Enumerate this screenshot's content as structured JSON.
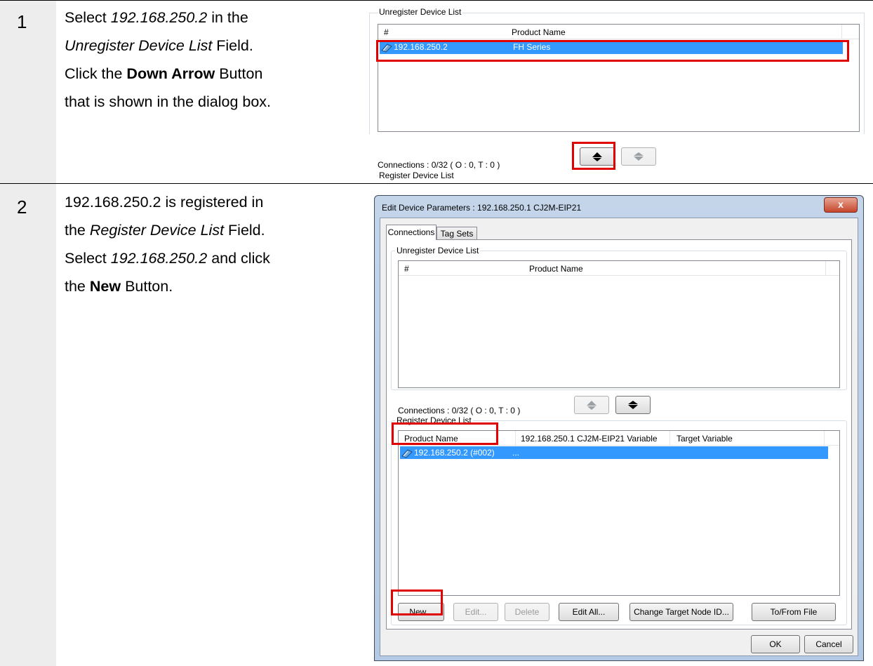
{
  "steps": [
    {
      "number": "1",
      "t1": "Select ",
      "t1_ip": "192.168.250.2",
      "t1_end": " in the",
      "t2_field": "Unregister Device List",
      "t2_end": " Field.",
      "t3_a": "Click the ",
      "t3_bold": "Down Arrow",
      "t3_end": " Button",
      "t4": "that is shown in the dialog box."
    },
    {
      "number": "2",
      "t1": "192.168.250.2 is registered in",
      "t2_a": "the ",
      "t2_field": "Register Device List",
      "t2_end": " Field.",
      "t3_a": "Select ",
      "t3_ip": "192.168.250.2",
      "t3_end": " and click",
      "t4_a": "the ",
      "t4_bold": "New",
      "t4_end": " Button."
    }
  ],
  "screenshot1": {
    "group_label": "Unregister Device List",
    "col_hash": "#",
    "col_product": "Product Name",
    "row_ip": "192.168.250.2",
    "row_product": "FH Series",
    "connections": "Connections :  0/32 ( O : 0, T : 0 )",
    "register_label": "Register Device List"
  },
  "dialog": {
    "title": "Edit Device Parameters : 192.168.250.1 CJ2M-EIP21",
    "close": "x",
    "tabs": [
      "Connections",
      "Tag Sets"
    ],
    "unregister_label": "Unregister Device List",
    "col_hash": "#",
    "col_product": "Product Name",
    "connections": "Connections :  0/32 ( O : 0, T : 0 )",
    "register_label": "Register Device List",
    "reg_col_product": "Product Name",
    "reg_col_var": "192.168.250.1 CJ2M-EIP21 Variable",
    "reg_col_target": "Target Variable",
    "reg_row": "192.168.250.2 (#002)",
    "reg_row_more": "...",
    "buttons": {
      "new": "New...",
      "edit": "Edit...",
      "delete": "Delete",
      "edit_all": "Edit All...",
      "change_target": "Change Target Node ID...",
      "to_from_file": "To/From File",
      "ok": "OK",
      "cancel": "Cancel"
    }
  },
  "colors": {
    "highlight": "#e00000",
    "selection": "#3399ff",
    "sidebar": "#ededed"
  }
}
